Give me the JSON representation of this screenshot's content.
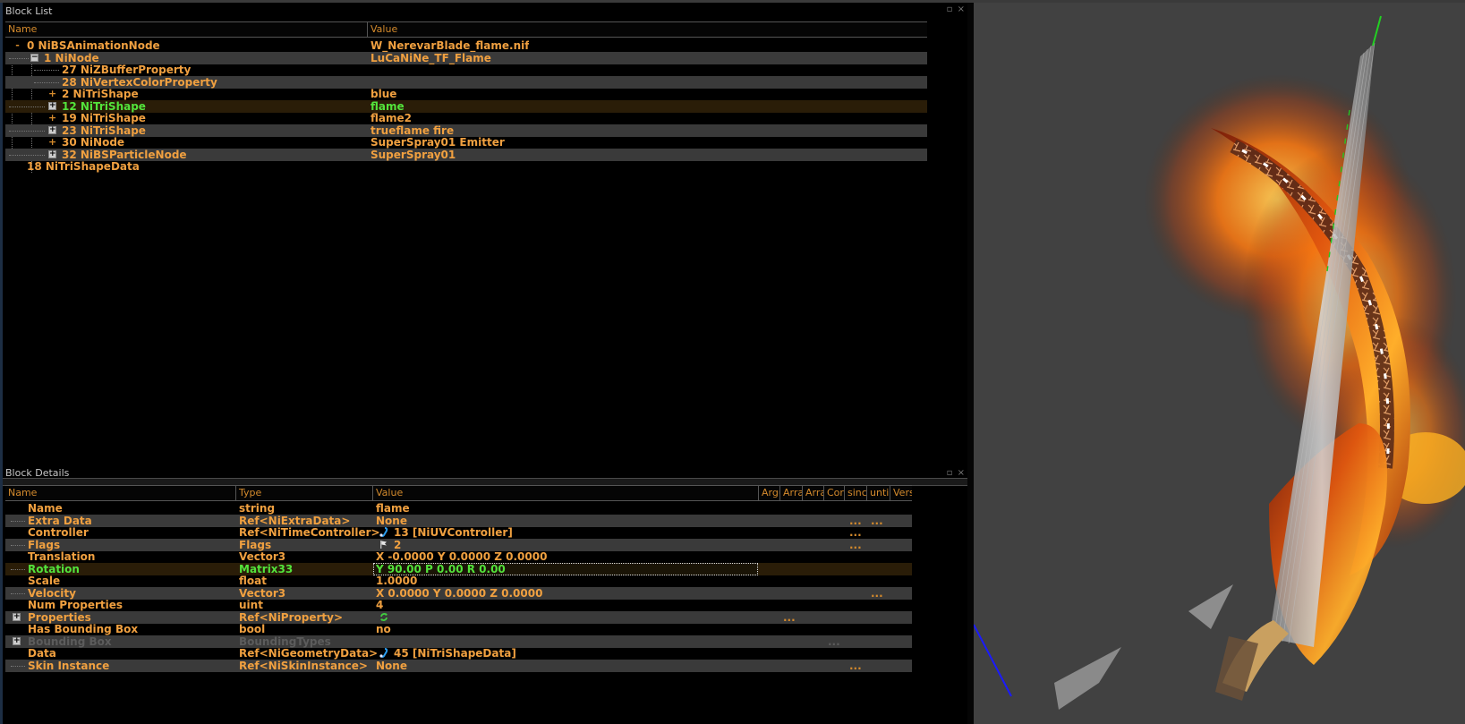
{
  "block_list": {
    "title": "Block List",
    "columns": {
      "name": "Name",
      "value": "Value"
    },
    "rows": [
      {
        "name": "0 NiBSAnimationNode",
        "value": "W_NerevarBlade_flame.nif"
      },
      {
        "name": "1 NiNode",
        "value": "LuCaNiNe_TF_Flame"
      },
      {
        "name": "27 NiZBufferProperty",
        "value": ""
      },
      {
        "name": "28 NiVertexColorProperty",
        "value": ""
      },
      {
        "name": "2 NiTriShape",
        "value": "blue"
      },
      {
        "name": "12 NiTriShape",
        "value": "flame"
      },
      {
        "name": "19 NiTriShape",
        "value": "flame2"
      },
      {
        "name": "23 NiTriShape",
        "value": "trueflame fire"
      },
      {
        "name": "30 NiNode",
        "value": "SuperSpray01 Emitter"
      },
      {
        "name": "32 NiBSParticleNode",
        "value": "SuperSpray01"
      },
      {
        "name": "18 NiTriShapeData",
        "value": ""
      }
    ]
  },
  "block_details": {
    "title": "Block Details",
    "columns": {
      "name": "Name",
      "type": "Type",
      "value": "Value",
      "arg": "Argu",
      "arr1": "Arra",
      "arr2": "Arra",
      "cond": "Cor",
      "since": "sinc",
      "until": "until",
      "ver": "Vers"
    },
    "rows": [
      {
        "name": "Name",
        "type": "string",
        "value": "flame"
      },
      {
        "name": "Extra Data",
        "type": "Ref<NiExtraData>",
        "value": "None",
        "dots": [
          "...",
          "..."
        ]
      },
      {
        "name": "Controller",
        "type": "Ref<NiTimeController>",
        "value": "13 [NiUVController]",
        "icon": "link-icon",
        "dots": [
          "..."
        ]
      },
      {
        "name": "Flags",
        "type": "Flags",
        "value": "2",
        "icon": "flag-icon",
        "dots": [
          "..."
        ]
      },
      {
        "name": "Translation",
        "type": "Vector3",
        "value": "X -0.0000 Y 0.0000 Z 0.0000"
      },
      {
        "name": "Rotation",
        "type": "Matrix33",
        "value": "Y 90.00 P 0.00 R 0.00"
      },
      {
        "name": "Scale",
        "type": "float",
        "value": "1.0000"
      },
      {
        "name": "Velocity",
        "type": "Vector3",
        "value": "X 0.0000 Y 0.0000 Z 0.0000",
        "dots": [
          "..."
        ]
      },
      {
        "name": "Num Properties",
        "type": "uint",
        "value": "4"
      },
      {
        "name": "Properties",
        "type": "Ref<NiProperty>",
        "value": "",
        "icon": "refresh-icon",
        "dots": [
          "..."
        ]
      },
      {
        "name": "Has Bounding Box",
        "type": "bool",
        "value": "no"
      },
      {
        "name": "Bounding Box",
        "type": "BoundingTypes",
        "value": "",
        "dots": [
          "..."
        ]
      },
      {
        "name": "Data",
        "type": "Ref<NiGeometryData>",
        "value": "45 [NiTriShapeData]",
        "icon": "link-icon"
      },
      {
        "name": "Skin Instance",
        "type": "Ref<NiSkinInstance>",
        "value": "None",
        "dots": [
          "..."
        ]
      }
    ]
  },
  "viewport": {
    "label": "3D render viewport",
    "background": "#414141",
    "axis_y_color": "#22d022",
    "axis_z_color": "#1a1aff"
  },
  "colors": {
    "text_orange": "#f0a040",
    "text_green": "#53e33b",
    "row_alt": "#3a3a3a",
    "panel_bg": "#000000"
  }
}
